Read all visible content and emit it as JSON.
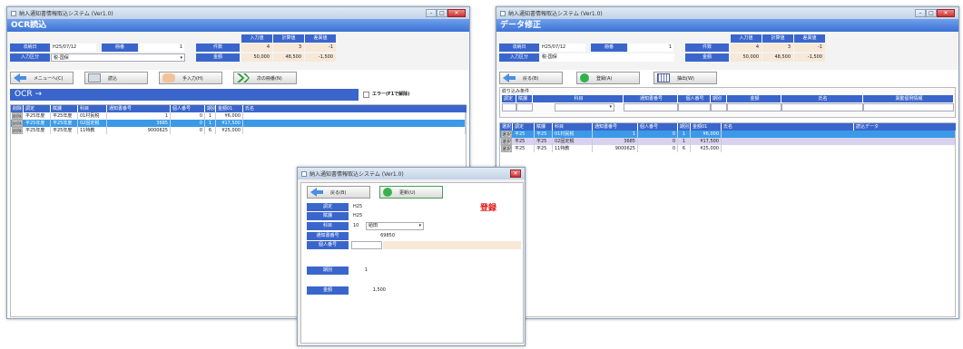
{
  "w1": {
    "title": "納入通知書情報取込システム (Ver1.0)",
    "header": "OCR読込",
    "f_date_label": "収納日",
    "f_date_value": "H25/07/12",
    "f_type_label": "入力区分",
    "f_type_value": "税-国保",
    "f_shoban_label": "冊番",
    "f_shoban_value": "1",
    "f_count_label": "件数",
    "f_amount_label": "金額",
    "cols": [
      "入力値",
      "計算値",
      "差異値"
    ],
    "count_vals": [
      "4",
      "3",
      "-1"
    ],
    "amount_vals": [
      "50,000",
      "48,500",
      "-1,500"
    ],
    "btn_menu": "メニューへ(C)",
    "btn_read": "読込",
    "btn_manual": "手入力(H)",
    "btn_next": "次の冊番(N)",
    "ocr_label": "OCR →",
    "error_check": "エラー(F1で解除)",
    "grid_headers": [
      "削除",
      "調定",
      "賦課",
      "科目",
      "通知書番号",
      "個人番号",
      "期別",
      "金額01",
      "氏名"
    ],
    "rows": [
      {
        "del": "削除",
        "c1": "平25年度",
        "c2": "平25年度",
        "c3": "01村民税",
        "c4": "1",
        "c5": "0",
        "c6": "1",
        "c7": "¥6,000",
        "c8": ""
      },
      {
        "del": "削除",
        "c1": "平25年度",
        "c2": "平25年度",
        "c3": "02固定税",
        "c4": "3685",
        "c5": "0",
        "c6": "1",
        "c7": "¥17,500",
        "c8": ""
      },
      {
        "del": "削除",
        "c1": "平25年度",
        "c2": "平25年度",
        "c3": "11特教",
        "c4": "9000625",
        "c5": "0",
        "c6": "6",
        "c7": "¥25,000",
        "c8": ""
      }
    ]
  },
  "w2": {
    "title": "納入通知書情報取込システム (Ver1.0)",
    "header": "データ修正",
    "f_date_label": "収納日",
    "f_date_value": "H25/07/12",
    "f_type_label": "入力区分",
    "f_type_value": "税-国保",
    "f_shoban_label": "冊番",
    "f_shoban_value": "1",
    "f_count_label": "件数",
    "f_amount_label": "金額",
    "cols": [
      "入力値",
      "計算値",
      "差異値"
    ],
    "count_vals": [
      "4",
      "3",
      "-1"
    ],
    "amount_vals": [
      "50,000",
      "48,500",
      "-1,500"
    ],
    "btn_back": "戻る(B)",
    "btn_register": "登録(A)",
    "btn_extract": "抽出(W)",
    "filter_title": "絞り込み条件",
    "filter_headers": [
      "調定",
      "賦課",
      "科目",
      "通知書番号",
      "個人番号",
      "期別",
      "金額",
      "氏名",
      "異動留例情報"
    ],
    "grid_headers": [
      "選択",
      "調定",
      "賦課",
      "科目",
      "通知書番号",
      "個人番号",
      "期別",
      "金額01",
      "氏名",
      "読込データ"
    ],
    "rows": [
      {
        "sel": "選択",
        "c1": "平25",
        "c2": "平25",
        "c3": "01村民税",
        "c4": "1",
        "c5": "0",
        "c6": "1",
        "c7": "¥6,000"
      },
      {
        "sel": "選択",
        "c1": "平25",
        "c2": "平25",
        "c3": "02固定税",
        "c4": "3685",
        "c5": "0",
        "c6": "1",
        "c7": "¥17,500"
      },
      {
        "sel": "選択",
        "c1": "平25",
        "c2": "平25",
        "c3": "11特教",
        "c4": "9000625",
        "c5": "0",
        "c6": "6",
        "c7": "¥25,000"
      }
    ]
  },
  "w3": {
    "title": "納入通知書情報取込システム (Ver1.0)",
    "btn_back": "戻る(B)",
    "btn_update": "更新(U)",
    "status": "登録",
    "l_chotei": "調定",
    "v_chotei": "H25",
    "l_fuka": "賦課",
    "v_fuka": "H25",
    "l_kamoku": "科目",
    "v_kamoku_code": "10",
    "v_kamoku_name": "給田",
    "l_tsuchi": "通知書番号",
    "v_tsuchi": "69850",
    "l_kojin": "個人番号",
    "v_kojin": "",
    "l_kibetsu": "期別",
    "v_kibetsu": "1",
    "l_kingaku": "金額",
    "v_kingaku": "1,500"
  }
}
